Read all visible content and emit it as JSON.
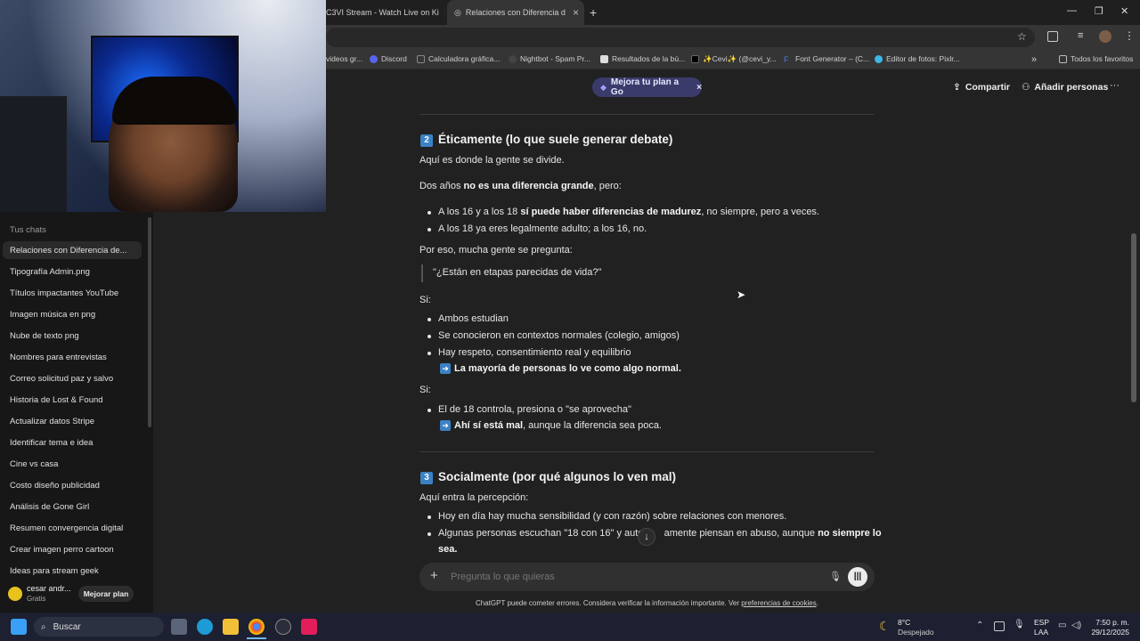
{
  "browser": {
    "tabs": [
      {
        "title": "C3VI Stream - Watch Live on Ki"
      },
      {
        "title": "Relaciones con Diferencia de Ed"
      }
    ],
    "new_tab": "+",
    "bookmarks": [
      "videos gr...",
      "Discord",
      "Calculadora gráfica...",
      "Nightbot - Spam Pr...",
      "Resultados de la bú...",
      "✨Cevi✨ (@cevi_y...",
      "Font Generator – (C...",
      "Editor de fotos: Pixlr..."
    ],
    "all_bookmarks": "Todos los favoritos"
  },
  "header": {
    "upgrade": "Mejora tu plan a Go",
    "share": "Compartir",
    "add_people": "Añadir personas",
    "more": "···"
  },
  "sidebar": {
    "section_title": "Tus chats",
    "chats": [
      "Relaciones con Diferencia de...",
      "Tipografía Admin.png",
      "Títulos impactantes YouTube",
      "Imagen música en png",
      "Nube de texto png",
      "Nombres para entrevistas",
      "Correo solicitud paz y salvo",
      "Historia de Lost & Found",
      "Actualizar datos Stripe",
      "Identificar tema e idea",
      "Cine vs casa",
      "Costo diseño publicidad",
      "Análisis de Gone Girl",
      "Resumen convergencia digital",
      "Crear imagen perro cartoon",
      "Ideas para stream geek"
    ],
    "user_name": "cesar andr...",
    "user_plan": "Gratis",
    "upgrade_button": "Mejorar plan"
  },
  "content": {
    "section2_num": "2",
    "section2_title": "Éticamente (lo que suele generar debate)",
    "p1": "Aquí es donde la gente se divide.",
    "p2_a": "Dos años ",
    "p2_b": "no es una diferencia grande",
    "p2_c": ", pero:",
    "b1_a": "A los 16 y a los 18 ",
    "b1_b": "sí puede haber diferencias de madurez",
    "b1_c": ", no siempre, pero a veces.",
    "b2": "A los 18 ya eres legalmente adulto; a los 16, no.",
    "p3": "Por eso, mucha gente se pregunta:",
    "quote": "\"¿Están en etapas parecidas de vida?\"",
    "si1": "Si:",
    "b3": "Ambos estudian",
    "b4": "Se conocieron en contextos normales (colegio, amigos)",
    "b5": "Hay respeto, consentimiento real y equilibrio",
    "r1": "La mayoría de personas lo ve como algo normal.",
    "si2": "Si:",
    "b6": "El de 18 controla, presiona o \"se aprovecha\"",
    "r2_a": "Ahí sí está mal",
    "r2_b": ", aunque la diferencia sea poca.",
    "section3_num": "3",
    "section3_title": "Socialmente (por qué algunos lo ven mal)",
    "p4": "Aquí entra la percepción:",
    "b7": "Hoy en día hay mucha sensibilidad (y con razón) sobre relaciones con menores.",
    "b8_a": "Algunas personas escuchan \"18 con 16\" y autom",
    "b8_b": "amente piensan en abuso, aunque ",
    "b8_c": "no siempre lo",
    "b8_d": "sea."
  },
  "composer": {
    "placeholder": "Pregunta lo que quieras",
    "disclaimer_a": "ChatGPT puede cometer errores. Considera verificar la información importante. Ver ",
    "disclaimer_link": "preferencias de cookies",
    "disclaimer_b": "."
  },
  "taskbar": {
    "search": "Buscar",
    "weather_temp": "8°C",
    "weather_desc": "Despejado",
    "lang1": "ESP",
    "lang2": "LAA",
    "time": "7:50 p. m.",
    "date": "29/12/2025"
  },
  "colors": {
    "accent": "#3b82c4",
    "upgrade_pill": "#3b3b6b",
    "background": "#212121",
    "sidebar": "#171717"
  }
}
